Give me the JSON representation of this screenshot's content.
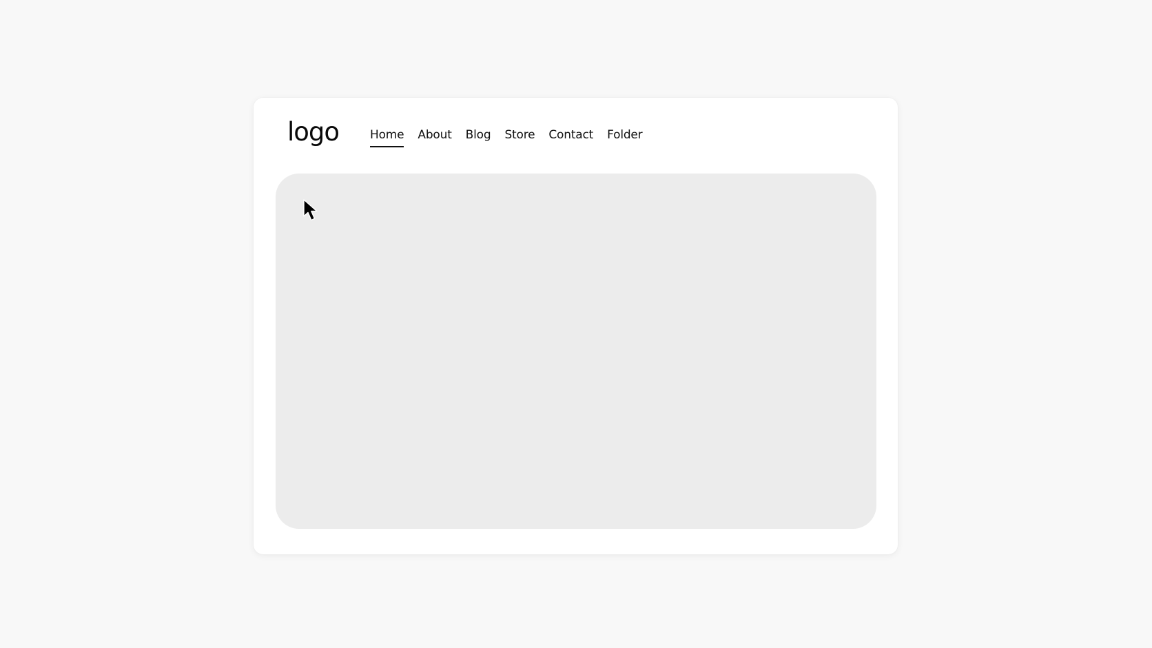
{
  "header": {
    "logo_text": "logo",
    "nav": {
      "items": [
        {
          "label": "Home",
          "active": true
        },
        {
          "label": "About",
          "active": false
        },
        {
          "label": "Blog",
          "active": false
        },
        {
          "label": "Store",
          "active": false
        },
        {
          "label": "Contact",
          "active": false
        },
        {
          "label": "Folder",
          "active": false
        }
      ]
    }
  },
  "hero": {
    "placeholder_color": "#ececec"
  },
  "cursor": {
    "icon": "mouse-pointer-icon"
  },
  "colors": {
    "page_background": "#f8f8f8",
    "card_background": "#ffffff",
    "text": "#111111"
  }
}
